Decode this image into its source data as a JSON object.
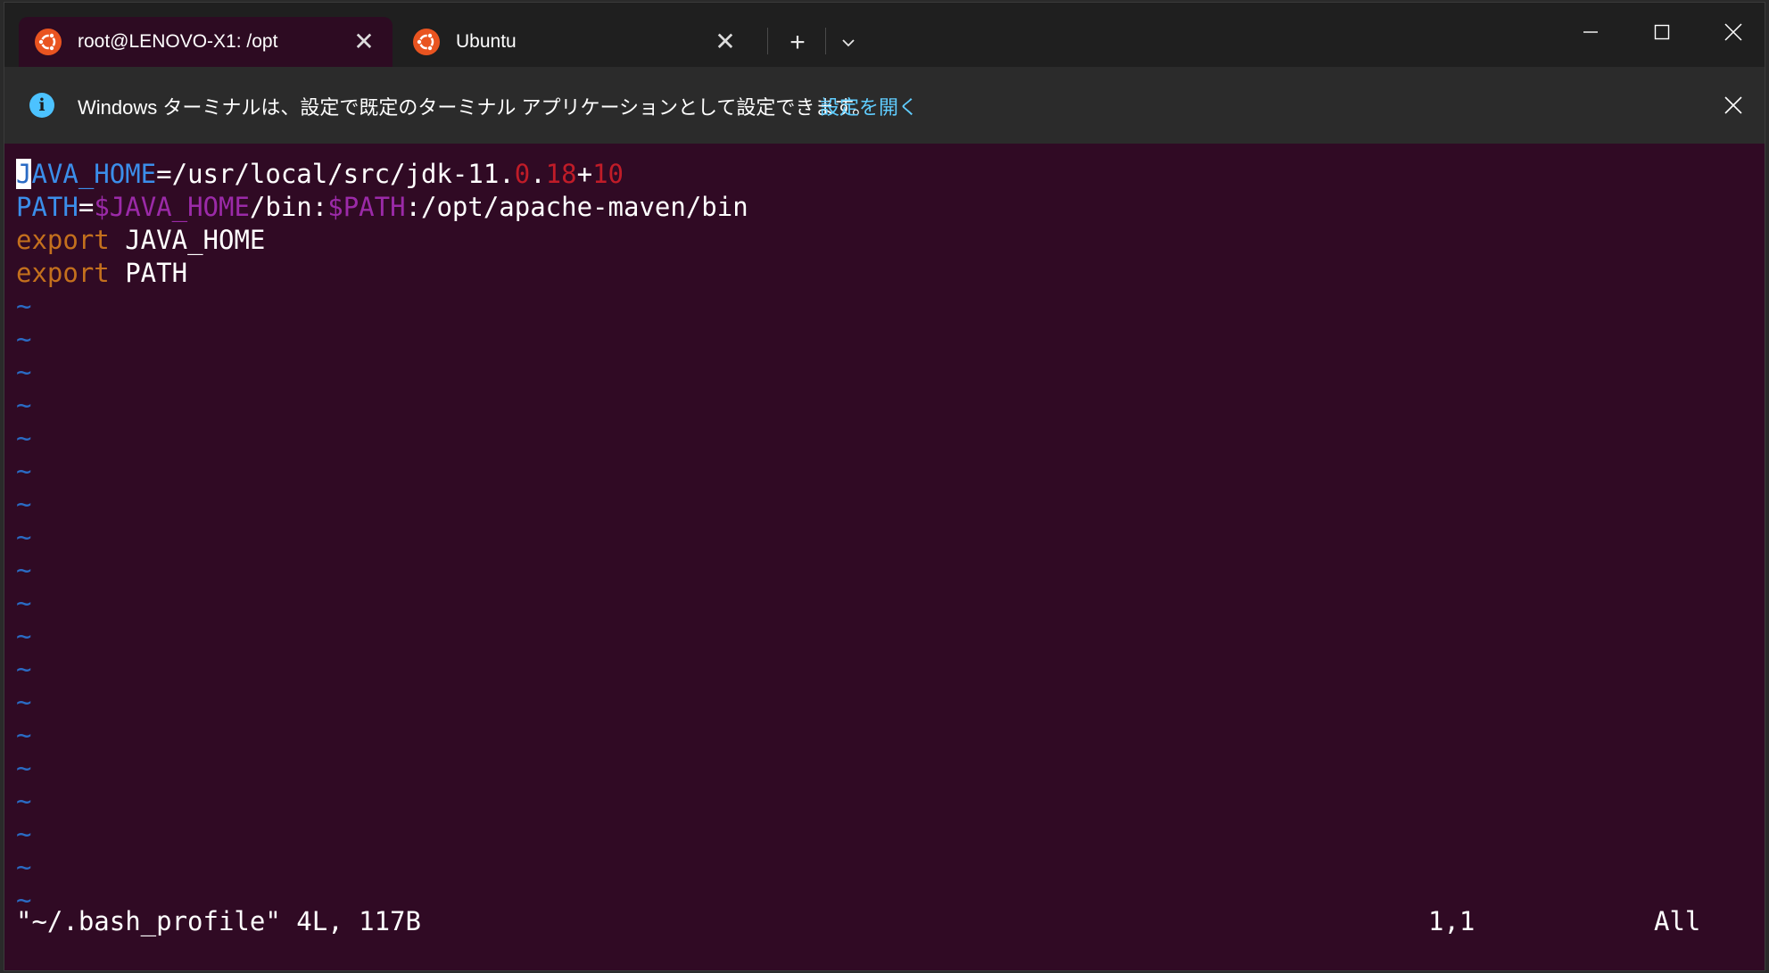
{
  "tabs": [
    {
      "title": "root@LENOVO-X1: /opt",
      "active": true,
      "icon": "ubuntu-icon",
      "close_glyph": "✕"
    },
    {
      "title": "Ubuntu",
      "active": false,
      "icon": "ubuntu-icon",
      "close_glyph": "✕"
    }
  ],
  "new_tab_glyph": "+",
  "infobar": {
    "icon_glyph": "i",
    "message": "Windows ターミナルは、設定で既定のターミナル アプリケーションとして設定できます。",
    "link": "設定を開く"
  },
  "editor": {
    "line1": {
      "cursor_char": "J",
      "var_rest": "AVA_HOME",
      "eq": "=",
      "path": "/usr/local/src/jdk-11.",
      "n1": "0",
      "dot": ".",
      "n2": "18",
      "plus": "+",
      "n3": "10"
    },
    "line2": {
      "var": "PATH",
      "eq": "=",
      "ref1": "$JAVA_HOME",
      "mid": "/bin:",
      "ref2": "$PATH",
      "rest": ":/opt/apache-maven/bin"
    },
    "line3": {
      "kw": "export",
      "arg": " JAVA_HOME"
    },
    "line4": {
      "kw": "export",
      "arg": " PATH"
    },
    "tilde": "~",
    "tilde_count": 19
  },
  "statusline": {
    "file": "\"~/.bash_profile\" 4L, 117B",
    "position": "1,1",
    "scroll": "All"
  },
  "colors": {
    "terminal_bg": "#300a24",
    "identifier": "#3b8eea",
    "variable_ref": "#9b2aa8",
    "number": "#c01c28",
    "keyword": "#c4701d",
    "tilde": "#2a6bc4",
    "link": "#60cdff",
    "ubuntu_orange": "#e95420"
  }
}
